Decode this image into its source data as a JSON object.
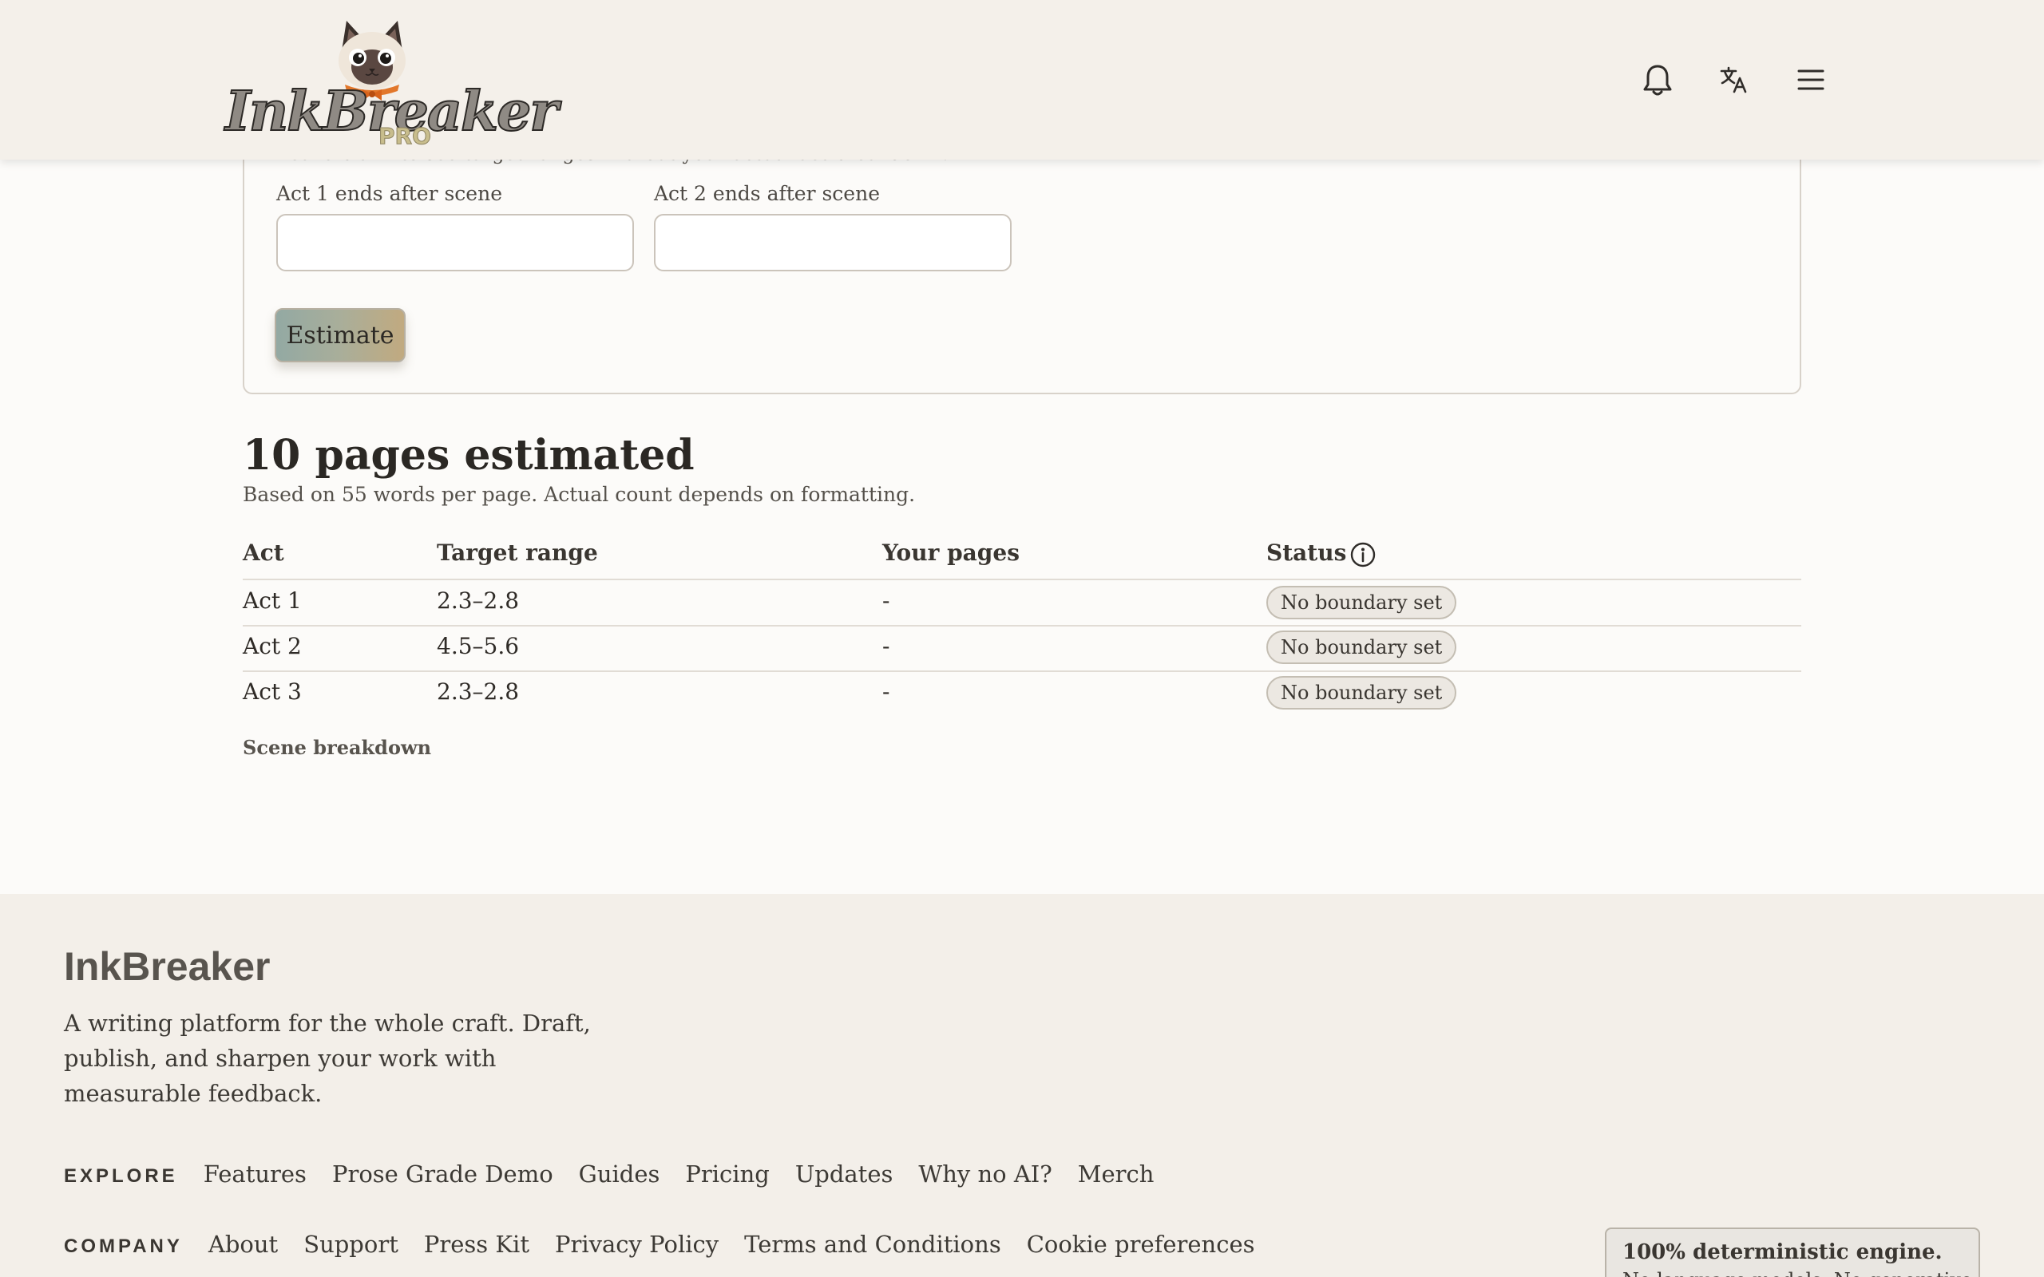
{
  "header": {
    "logo_word": "InkBreaker",
    "logo_badge": "PRO",
    "icons": [
      "bell-icon",
      "translate-icon",
      "hamburger-menu-icon"
    ]
  },
  "form": {
    "hint": "Leave blank to see target ranges without your actual act breakdown.",
    "act1_label": "Act 1 ends after scene",
    "act1_value": "",
    "act2_label": "Act 2 ends after scene",
    "act2_value": "",
    "estimate_label": "Estimate"
  },
  "results": {
    "title": "10 pages estimated",
    "subtitle": "Based on 55 words per page. Actual count depends on formatting.",
    "columns": [
      "Act",
      "Target range",
      "Your pages",
      "Status"
    ],
    "rows": [
      {
        "act": "Act 1",
        "range": "2.3–2.8",
        "pages": "-",
        "status": "No boundary set"
      },
      {
        "act": "Act 2",
        "range": "4.5–5.6",
        "pages": "-",
        "status": "No boundary set"
      },
      {
        "act": "Act 3",
        "range": "2.3–2.8",
        "pages": "-",
        "status": "No boundary set"
      }
    ],
    "scene_breakdown": "Scene breakdown"
  },
  "footer": {
    "brand": "InkBreaker",
    "description": "A writing platform for the whole craft. Draft, publish, and sharpen your work with measurable feedback.",
    "explore_heading": "EXPLORE",
    "explore_links": [
      "Features",
      "Prose Grade Demo",
      "Guides",
      "Pricing",
      "Updates",
      "Why no AI?",
      "Merch"
    ],
    "company_heading": "COMPANY",
    "company_links": [
      "About",
      "Support",
      "Press Kit",
      "Privacy Policy",
      "Terms and Conditions",
      "Cookie preferences"
    ],
    "engine_line1": "100% deterministic engine.",
    "engine_line2": "No language models. No generative AI."
  },
  "colors": {
    "header_bg": "#f4f0ea",
    "page_bg": "#fcfbf9",
    "footer_bg": "#f3efe9",
    "button_gradient_start": "#93a9a3",
    "button_gradient_end": "#c1aa80",
    "badge_bg": "#ece8e2"
  }
}
